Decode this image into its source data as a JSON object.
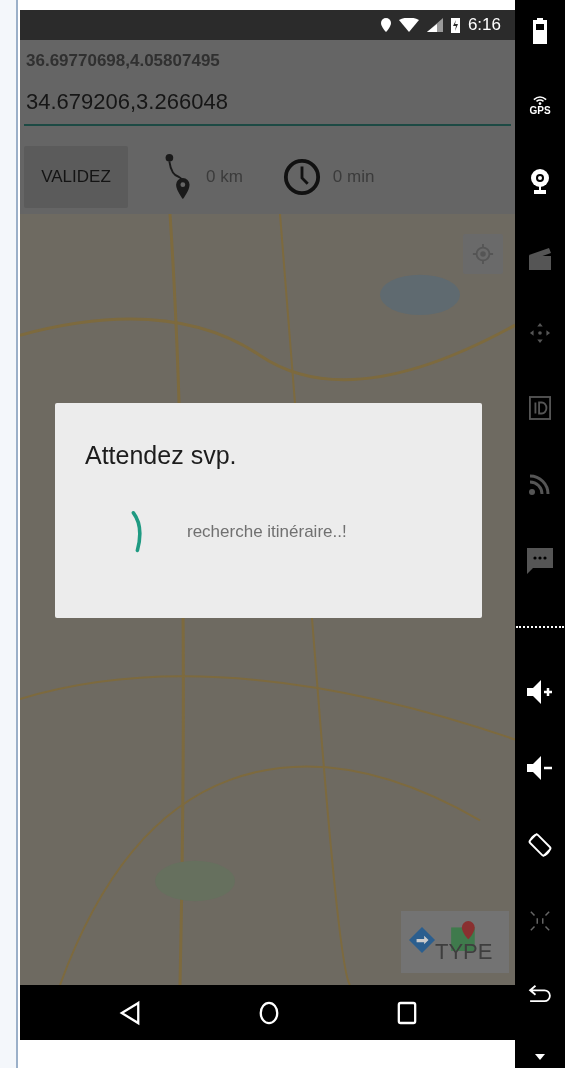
{
  "status_bar": {
    "time": "6:16"
  },
  "origin_field": {
    "value": "36.69770698,4.05807495"
  },
  "destination_field": {
    "value": "34.679206,3.266048"
  },
  "route_bar": {
    "validate_button": "VALIDEZ",
    "distance": "0 km",
    "duration": "0 min"
  },
  "map": {
    "kind": "picture",
    "type_button": "TYPE"
  },
  "emulator_toolbar": {
    "gps_label": "GPS"
  },
  "dialog": {
    "title": "Attendez svp.",
    "message": "recherche itinéraire..!"
  }
}
